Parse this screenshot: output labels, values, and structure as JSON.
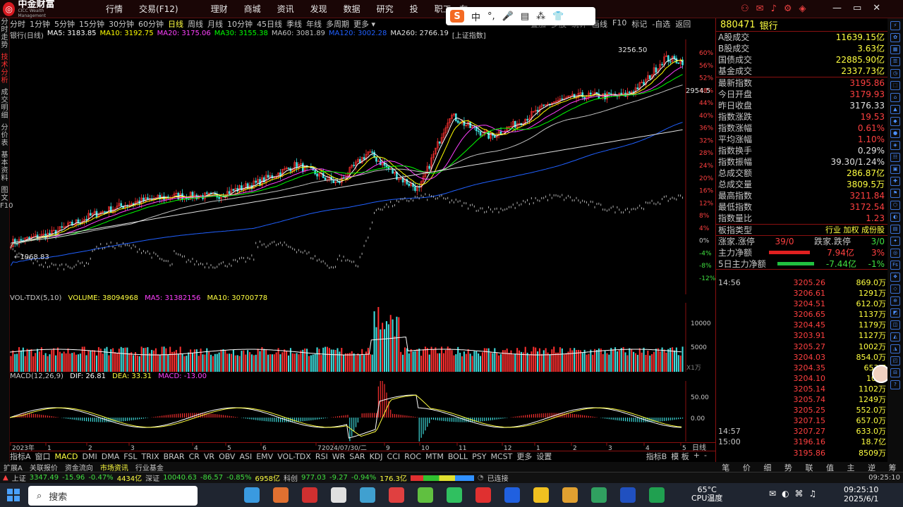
{
  "app": {
    "logo_text": "中金财富",
    "logo_sub": "CICC Wealth Management"
  },
  "top_menu": [
    "行情",
    "交易(F12)",
    "",
    "理财",
    "商城",
    "资讯",
    "发现",
    "数据",
    "研究",
    "投",
    "职工...在"
  ],
  "ime": [
    "中",
    "°,",
    "🎤",
    "▤",
    "⁂",
    "👕"
  ],
  "periods": [
    "分时",
    "1分钟",
    "5分钟",
    "15分钟",
    "30分钟",
    "60分钟",
    "日线",
    "周线",
    "月线",
    "10分钟",
    "45日线",
    "季线",
    "年线",
    "多周期",
    "更多 ▾"
  ],
  "active_period": "日线",
  "right_tools": [
    "叠加",
    "多股",
    "统计",
    "画线",
    "F10",
    "标记",
    "-自选",
    "返回"
  ],
  "left_tabs": [
    {
      "label": "分时走势",
      "active": false
    },
    {
      "label": "技术分析",
      "active": true
    },
    {
      "label": "成交明细",
      "active": false
    },
    {
      "label": "分价表",
      "active": false
    },
    {
      "label": "基本资料",
      "active": false
    },
    {
      "label": "图文F10",
      "active": false
    }
  ],
  "ma_legend": {
    "stock": "银行(日线)",
    "ma5": "MA5: 3183.85",
    "ma10": "MA10: 3192.75",
    "ma20": "MA20: 3175.06",
    "ma30": "MA30: 3155.38",
    "ma60": "MA60: 3081.89",
    "ma120": "MA120: 3002.28",
    "ma260": "MA260: 2766.19",
    "bracket": "[上证指数]"
  },
  "colors": {
    "ma5": "#ffffff",
    "ma10": "#ffff00",
    "ma20": "#ff40ff",
    "ma30": "#00ff00",
    "ma60": "#c0c0c0",
    "ma120": "#2060ff",
    "ma260": "#e0e0e0",
    "up": "#ff3030",
    "down": "#40e0e0",
    "accent": "#ffff40"
  },
  "price_annotations": {
    "high": "3256.50",
    "low": "1968.83",
    "level": "2954.5"
  },
  "y_axis_pct": [
    "60%",
    "56%",
    "52%",
    "48%",
    "44%",
    "40%",
    "36%",
    "32%",
    "28%",
    "24%",
    "20%",
    "16%",
    "12%",
    "8%",
    "4%",
    "0%",
    "-4%",
    "-8%",
    "-12%"
  ],
  "volume": {
    "legend": "VOL-TDX(5,10)",
    "volume": "VOLUME: 38094968",
    "ma5": "MA5: 31382156",
    "ma10": "MA10: 30700778",
    "ticks": [
      "10000",
      "5000"
    ],
    "unit": "X1万"
  },
  "macd": {
    "legend": "MACD(12,26,9)",
    "dif": "DIF: 26.81",
    "dea": "DEA: 33.31",
    "macd": "MACD: -13.00",
    "ticks": [
      "50.00",
      "0.00"
    ]
  },
  "x_axis": {
    "labels": [
      "2023年",
      "1",
      "2",
      "3",
      "4",
      "5",
      "6",
      "7",
      "2024/07/30/二",
      "9",
      "10",
      "11",
      "12",
      "1",
      "2",
      "3",
      "4",
      "5"
    ],
    "period_label": "日线"
  },
  "indicators": [
    "指标A",
    "窗口",
    "MACD",
    "DMI",
    "DMA",
    "FSL",
    "TRIX",
    "BRAR",
    "CR",
    "VR",
    "OBV",
    "ASI",
    "EMV",
    "VOL-TDX",
    "RSI",
    "WR",
    "SAR",
    "KDJ",
    "CCI",
    "ROC",
    "MTM",
    "BOLL",
    "PSY",
    "MCST",
    "更多",
    "设置"
  ],
  "indicator_active": "MACD",
  "indicator_right": [
    "指标B",
    "模 板",
    "+",
    "-"
  ],
  "bottom_tabs": [
    "扩展A",
    "关联报价",
    "资金流向",
    "市场资讯",
    "行业基金"
  ],
  "status": {
    "sh_label": "上证",
    "sh_val": "3347.49",
    "sh_chg": "-15.96",
    "sh_pct": "-0.47%",
    "sh_amt": "4434亿",
    "sz_label": "深证",
    "sz_val": "10040.63",
    "sz_chg": "-86.57",
    "sz_pct": "-0.85%",
    "sz_amt": "6958亿",
    "kc_label": "科创",
    "kc_val": "977.03",
    "kc_chg": "-9.27",
    "kc_pct": "-0.94%",
    "kc_amt": "176.3亿",
    "conn": "已连接",
    "time": "09:25:10"
  },
  "quote": {
    "code": "880471",
    "name": "银行",
    "rows1": [
      {
        "k": "A股成交",
        "v": "11639.15亿",
        "c": "#ffff40"
      },
      {
        "k": "B股成交",
        "v": "3.63亿",
        "c": "#ffff40"
      },
      {
        "k": "国债成交",
        "v": "22885.90亿",
        "c": "#ffff40"
      },
      {
        "k": "基金成交",
        "v": "2337.73亿",
        "c": "#ffff40"
      }
    ],
    "rows2": [
      {
        "k": "最新指数",
        "v": "3195.86",
        "c": "#ff4040"
      },
      {
        "k": "今日开盘",
        "v": "3179.93",
        "c": "#ff4040"
      },
      {
        "k": "昨日收盘",
        "v": "3176.33",
        "c": "#e0e0e0"
      },
      {
        "k": "指数涨跌",
        "v": "19.53",
        "c": "#ff4040"
      },
      {
        "k": "指数涨幅",
        "v": "0.61%",
        "c": "#ff4040"
      },
      {
        "k": "平均涨幅",
        "v": "1.10%",
        "c": "#ff4040"
      },
      {
        "k": "指数换手",
        "v": "0.29%",
        "c": "#e0e0e0"
      },
      {
        "k": "指数振幅",
        "v": "39.30/1.24%",
        "c": "#e0e0e0"
      },
      {
        "k": "总成交额",
        "v": "286.87亿",
        "c": "#ffff40"
      },
      {
        "k": "总成交量",
        "v": "3809.5万",
        "c": "#ffff40"
      },
      {
        "k": "最高指数",
        "v": "3211.84",
        "c": "#ff4040"
      },
      {
        "k": "最低指数",
        "v": "3172.54",
        "c": "#ff4040"
      },
      {
        "k": "指数量比",
        "v": "1.23",
        "c": "#ff4040"
      }
    ],
    "type_label": "板指类型",
    "type_vals": "行业 加权 成份股",
    "zhang_label": "涨家.涨停",
    "zhang_val": "39/0",
    "die_label": "跌家.跌停",
    "die_val": "3/0",
    "flow1_label": "主力净额",
    "flow1_val": "7.94亿",
    "flow1_pct": "3%",
    "flow2_label": "5日主力净额",
    "flow2_val": "-7.44亿",
    "flow2_pct": "-1%"
  },
  "ticks": [
    {
      "t": "14:56",
      "p": "3205.26",
      "v": "869.0万"
    },
    {
      "t": "",
      "p": "3206.61",
      "v": "1291万"
    },
    {
      "t": "",
      "p": "3204.51",
      "v": "612.0万"
    },
    {
      "t": "",
      "p": "3206.65",
      "v": "1137万"
    },
    {
      "t": "",
      "p": "3204.45",
      "v": "1179万"
    },
    {
      "t": "",
      "p": "3203.91",
      "v": "1127万"
    },
    {
      "t": "",
      "p": "3205.27",
      "v": "1002万"
    },
    {
      "t": "",
      "p": "3204.03",
      "v": "854.0万"
    },
    {
      "t": "",
      "p": "3204.35",
      "v": "653.7"
    },
    {
      "t": "",
      "p": "3204.10",
      "v": "1002"
    },
    {
      "t": "",
      "p": "3205.14",
      "v": "1102万"
    },
    {
      "t": "",
      "p": "3205.74",
      "v": "1249万"
    },
    {
      "t": "",
      "p": "3205.25",
      "v": "552.0万"
    },
    {
      "t": "",
      "p": "3207.15",
      "v": "657.0万"
    },
    {
      "t": "14:57",
      "p": "3207.27",
      "v": "633.0万"
    },
    {
      "t": "15:00",
      "p": "3196.16",
      "v": "18.7亿"
    },
    {
      "t": "",
      "p": "3195.86",
      "v": "8509万"
    }
  ],
  "right_tabs": [
    "笔",
    "价",
    "细",
    "势",
    "联",
    "值",
    "主",
    "逆",
    "筹"
  ],
  "taskbar": {
    "search": "搜索",
    "weather_temp": "65°C",
    "weather_label": "CPU温度",
    "time": "09:25:10",
    "date": "2025/6/1"
  },
  "chart_data": {
    "type": "candlestick",
    "series": [
      {
        "name": "MA5",
        "values": [
          3183.85
        ]
      },
      {
        "name": "MA10",
        "values": [
          3192.75
        ]
      },
      {
        "name": "MA20",
        "values": [
          3175.06
        ]
      },
      {
        "name": "MA30",
        "values": [
          3155.38
        ]
      },
      {
        "name": "MA60",
        "values": [
          3081.89
        ]
      },
      {
        "name": "MA120",
        "values": [
          3002.28
        ]
      },
      {
        "name": "MA260",
        "values": [
          2766.19
        ]
      }
    ],
    "y_pct_range": [
      -12,
      60
    ],
    "high": 3256.5,
    "low": 1968.83
  }
}
